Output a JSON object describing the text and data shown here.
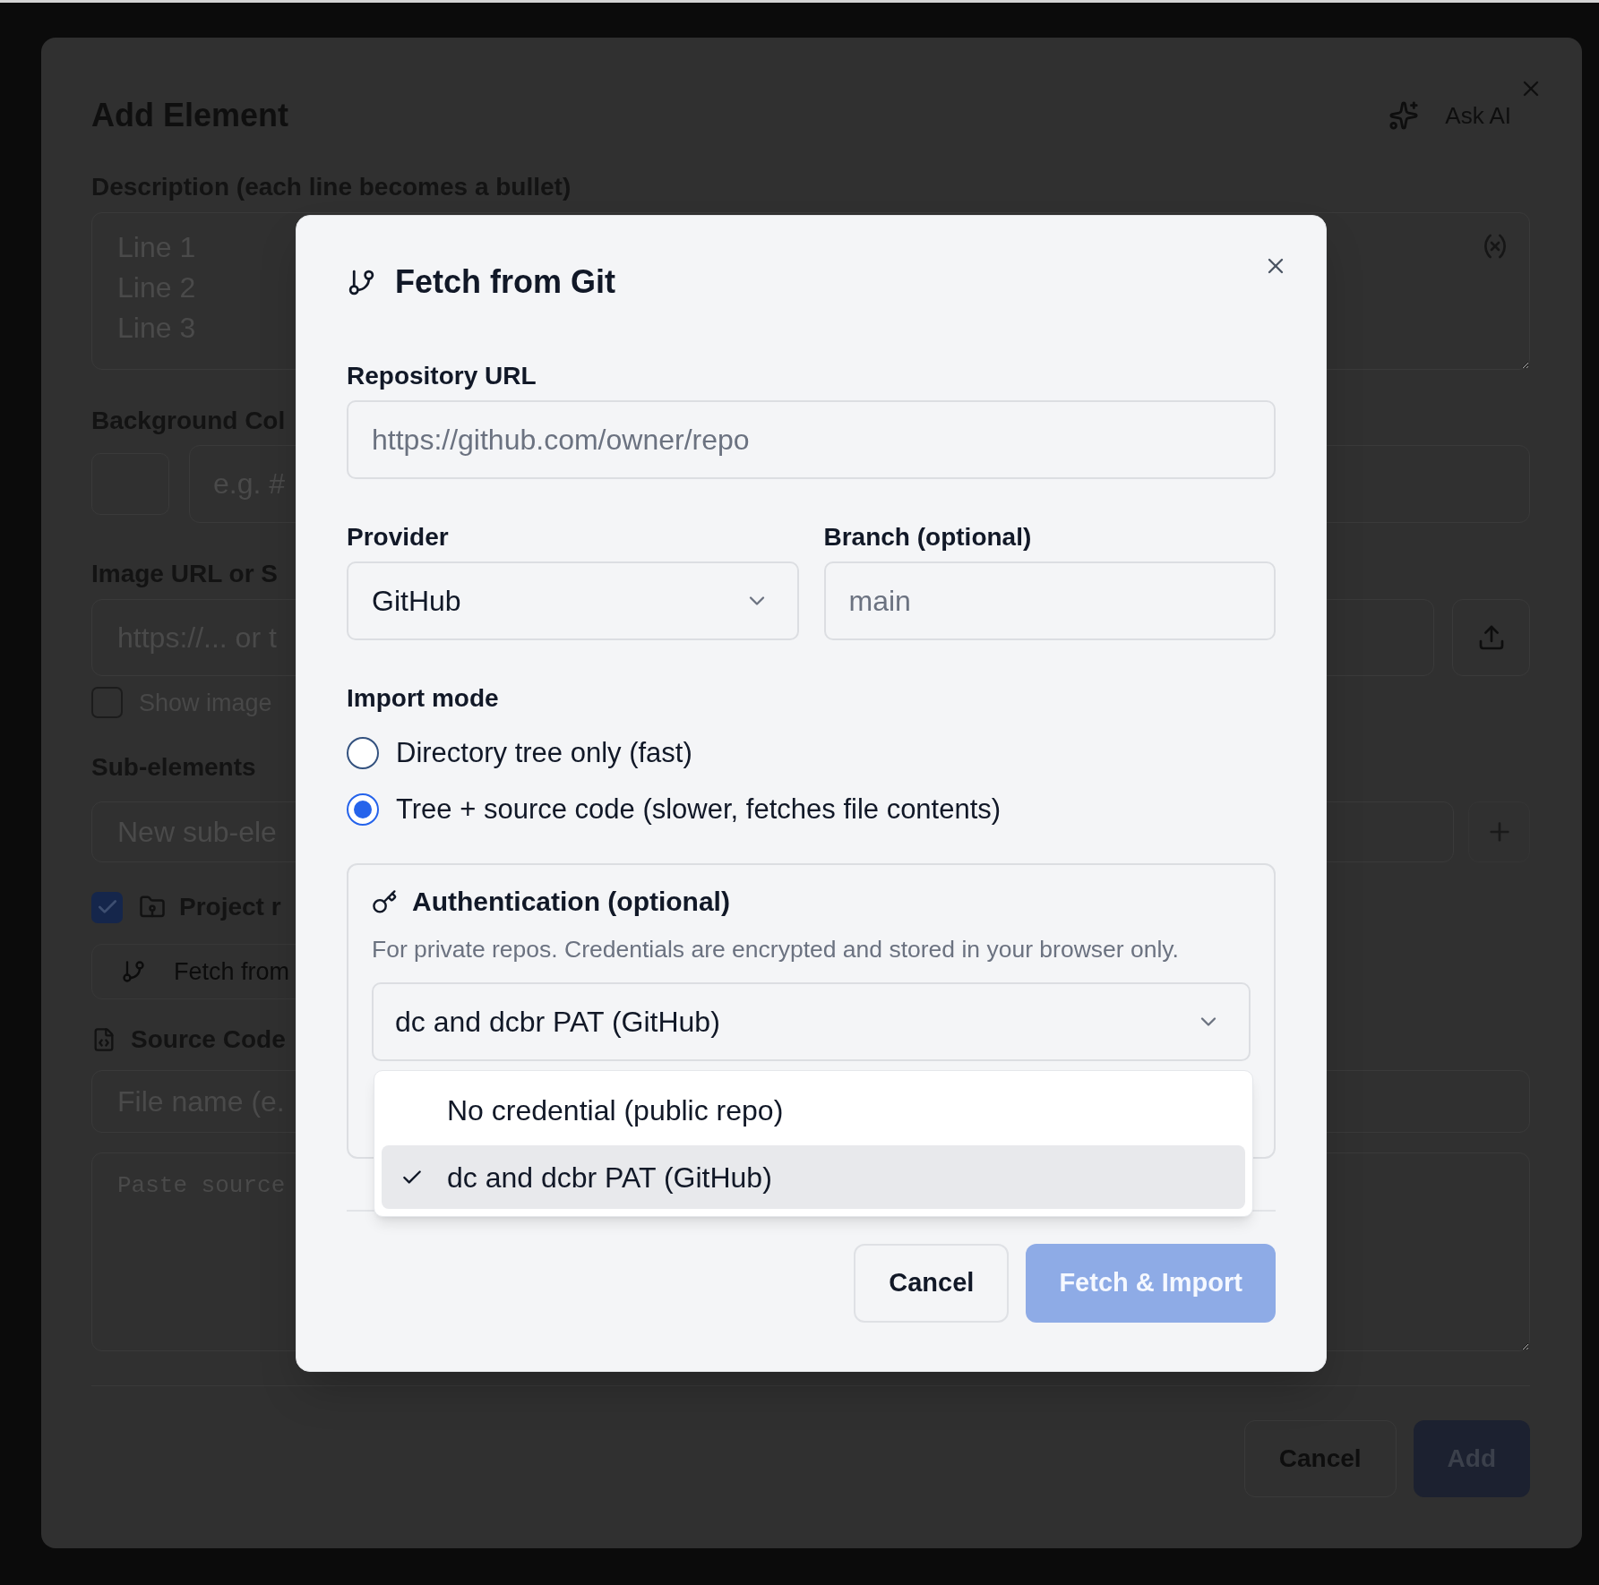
{
  "add_element_dialog": {
    "title": "Add Element",
    "ask_ai_button": "Ask AI",
    "description": {
      "label": "Description (each line becomes a bullet)",
      "placeholder": "Line 1\nLine 2\nLine 3"
    },
    "background_color": {
      "label": "Background Col",
      "placeholder": "e.g. #"
    },
    "image_url": {
      "label": "Image URL or S",
      "placeholder": "https://... or t",
      "show_image": {
        "label": "Show image",
        "checked": false
      }
    },
    "sub_elements": {
      "label": "Sub-elements",
      "placeholder": "New sub-ele"
    },
    "project_root": {
      "label": "Project r",
      "checked": true
    },
    "fetch_button": "Fetch from",
    "source_code": {
      "label": "Source Code",
      "file_name_placeholder": "File name (e.",
      "code_placeholder": "Paste source"
    },
    "buttons": [
      {
        "label": "Cancel",
        "kind": "secondary",
        "disabled": false
      },
      {
        "label": "Add",
        "kind": "primary",
        "disabled": true
      }
    ]
  },
  "fetch_dialog": {
    "title": "Fetch from Git",
    "repository_url": {
      "label": "Repository URL",
      "placeholder": "https://github.com/owner/repo"
    },
    "provider": {
      "label": "Provider",
      "value": "GitHub"
    },
    "branch": {
      "label": "Branch (optional)",
      "placeholder": "main"
    },
    "import_mode": {
      "label": "Import mode",
      "options": [
        {
          "label": "Directory tree only (fast)",
          "selected": false
        },
        {
          "label": "Tree + source code (slower, fetches file contents)",
          "selected": true
        }
      ]
    },
    "authentication": {
      "title": "Authentication (optional)",
      "description": "For private repos. Credentials are encrypted and stored in your browser only.",
      "credential": {
        "value": "dc and dcbr PAT (GitHub)",
        "expanded": true
      },
      "menu": [
        {
          "label": "No credential (public repo)",
          "selected": false
        },
        {
          "label": "dc and dcbr PAT (GitHub)",
          "selected": true
        }
      ]
    },
    "buttons": [
      {
        "label": "Cancel",
        "kind": "secondary",
        "disabled": false
      },
      {
        "label": "Fetch & Import",
        "kind": "primary",
        "disabled": true
      }
    ]
  }
}
